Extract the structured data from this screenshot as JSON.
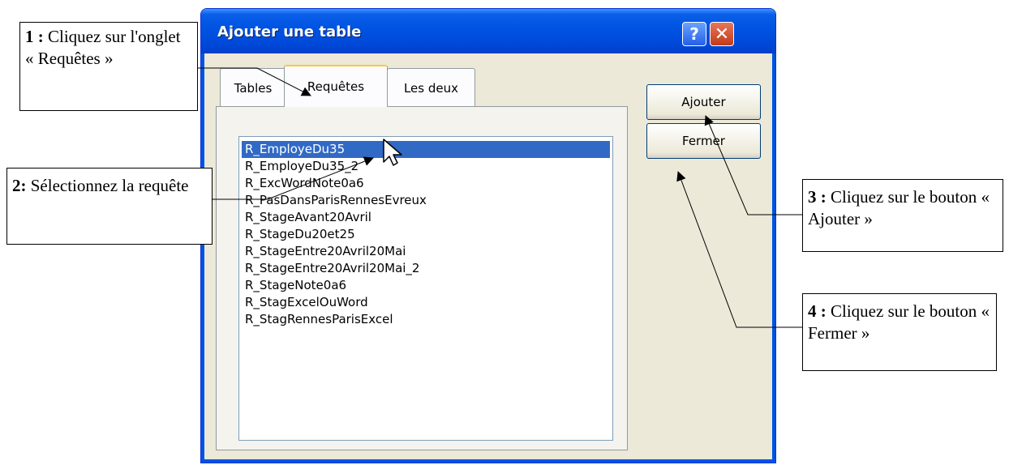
{
  "dialog": {
    "title": "Ajouter une table",
    "help_label": "?",
    "close_label": "✕",
    "tabs": [
      {
        "label": "Tables",
        "active": false
      },
      {
        "label": "Requêtes",
        "active": true
      },
      {
        "label": "Les deux",
        "active": false
      }
    ],
    "items": [
      "R_EmployeDu35",
      "R_EmployeDu35_2",
      "R_ExcWordNote0a6",
      "R_PasDansParisRennesEvreux",
      "R_StageAvant20Avril",
      "R_StageDu20et25",
      "R_StageEntre20Avril20Mai",
      "R_StageEntre20Avril20Mai_2",
      "R_StageNote0a6",
      "R_StagExcelOuWord",
      "R_StagRennesParisExcel"
    ],
    "selected_index": 0,
    "add_label": "Ajouter",
    "close_button_label": "Fermer"
  },
  "annotations": {
    "step1": {
      "num": "1 :",
      "text": " Cliquez sur l'onglet « Requêtes »"
    },
    "step2": {
      "num": "2:",
      "text": "  Sélectionnez la requête"
    },
    "step3": {
      "num": "3 :",
      "text": " Cliquez sur le bouton « Ajouter »"
    },
    "step4": {
      "num": "4 :",
      "text": " Cliquez sur le bouton « Fermer »"
    }
  },
  "colors": {
    "title_bar": "#0054e3",
    "selection": "#316ac5",
    "active_tab_accent": "#ffc83c",
    "window_bg": "#ece9d8"
  }
}
